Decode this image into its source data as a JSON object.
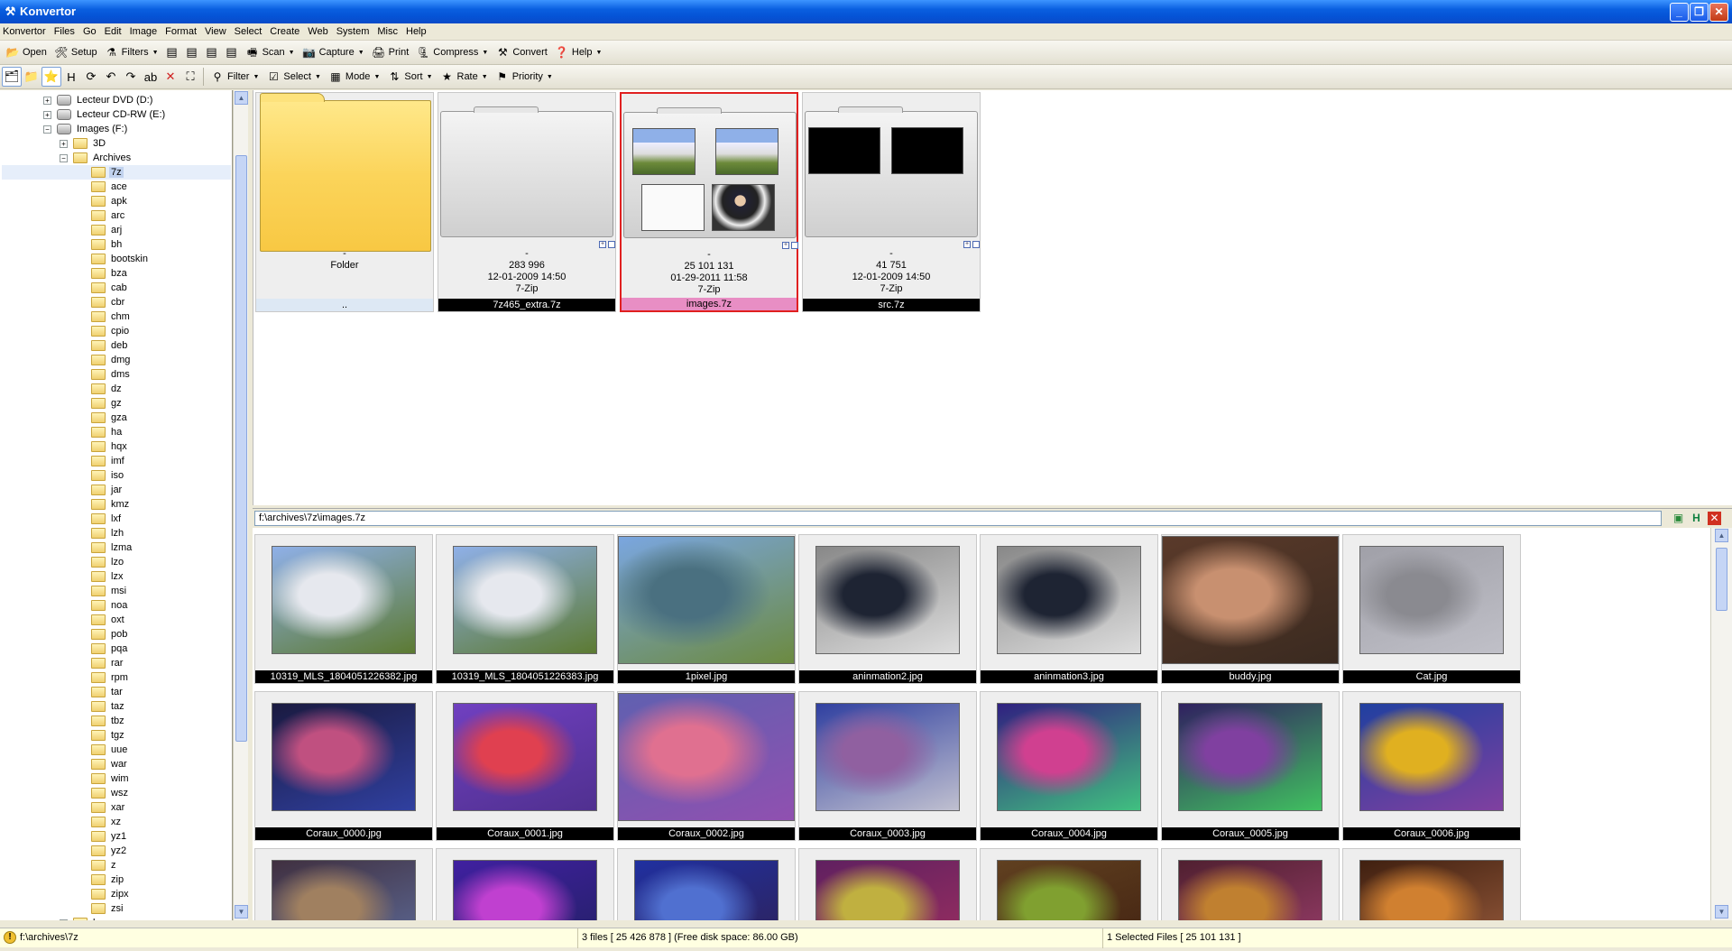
{
  "window": {
    "title": "Konvertor"
  },
  "menu": [
    "Konvertor",
    "Files",
    "Go",
    "Edit",
    "Image",
    "Format",
    "View",
    "Select",
    "Create",
    "Web",
    "System",
    "Misc",
    "Help"
  ],
  "toolbar1": [
    {
      "label": "Open",
      "icon": "open-icon",
      "glyph": "📂"
    },
    {
      "label": "Setup",
      "icon": "setup-icon",
      "glyph": "🛠"
    },
    {
      "label": "Filters",
      "icon": "filters-icon",
      "glyph": "⚗",
      "dropdown": true
    }
  ],
  "toolbar1b": [
    {
      "label": "Scan",
      "icon": "scan-icon",
      "glyph": "🖷",
      "dropdown": true
    },
    {
      "label": "Capture",
      "icon": "capture-icon",
      "glyph": "📷",
      "dropdown": true
    },
    {
      "label": "Print",
      "icon": "print-icon",
      "glyph": "🖨"
    },
    {
      "label": "Compress",
      "icon": "compress-icon",
      "glyph": "🗜",
      "dropdown": true
    },
    {
      "label": "Convert",
      "icon": "convert-icon",
      "glyph": "⚒"
    },
    {
      "label": "Help",
      "icon": "help-icon",
      "glyph": "❓",
      "dropdown": true
    }
  ],
  "toolbar2": [
    {
      "label": "Filter",
      "icon": "filter-icon",
      "glyph": "⚲"
    },
    {
      "label": "Select",
      "icon": "select-icon",
      "glyph": "☑"
    },
    {
      "label": "Mode",
      "icon": "mode-icon",
      "glyph": "▦"
    },
    {
      "label": "Sort",
      "icon": "sort-icon",
      "glyph": "⇅"
    },
    {
      "label": "Rate",
      "icon": "rate-icon",
      "glyph": "★"
    },
    {
      "label": "Priority",
      "icon": "priority-icon",
      "glyph": "⚑"
    }
  ],
  "tree": {
    "drives": [
      {
        "label": "Lecteur DVD (D:)",
        "expander": "+"
      },
      {
        "label": "Lecteur CD-RW (E:)",
        "expander": "+"
      },
      {
        "label": "Images (F:)",
        "expander": "−"
      }
    ],
    "level1": [
      {
        "label": "3D",
        "expander": "+"
      },
      {
        "label": "Archives",
        "expander": "−"
      }
    ],
    "archives": [
      "7z",
      "ace",
      "apk",
      "arc",
      "arj",
      "bh",
      "bootskin",
      "bza",
      "cab",
      "cbr",
      "chm",
      "cpio",
      "deb",
      "dmg",
      "dms",
      "dz",
      "gz",
      "gza",
      "ha",
      "hqx",
      "imf",
      "iso",
      "jar",
      "kmz",
      "lxf",
      "lzh",
      "lzma",
      "lzo",
      "lzx",
      "msi",
      "noa",
      "oxt",
      "pob",
      "pqa",
      "rar",
      "rpm",
      "tar",
      "taz",
      "tbz",
      "tgz",
      "uue",
      "war",
      "wim",
      "wsz",
      "xar",
      "xz",
      "yz1",
      "yz2",
      "z",
      "zip",
      "zipx",
      "zsi"
    ],
    "selected": "7z",
    "last": {
      "label": "bases",
      "expander": "+"
    }
  },
  "folders": [
    {
      "name": "..",
      "lines": [
        "-",
        "Folder"
      ],
      "kind": "folder"
    },
    {
      "name": "7z465_extra.7z",
      "lines": [
        "-",
        "283 996",
        "12-01-2009  14:50",
        "7-Zip"
      ],
      "kind": "empty"
    },
    {
      "name": "images.7z",
      "lines": [
        "-",
        "25 101 131",
        "01-29-2011  11:58",
        "7-Zip"
      ],
      "kind": "images",
      "selected": true
    },
    {
      "name": "src.7z",
      "lines": [
        "-",
        "41 751",
        "12-01-2009  14:50",
        "7-Zip"
      ],
      "kind": "src"
    }
  ],
  "path": "f:\\archives\\7z\\images.7z",
  "images": [
    {
      "name": "10319_MLS_1804051226382.jpg",
      "c1": "#8fb0e8",
      "c2": "#e6e8ee",
      "c3": "#5c7a32"
    },
    {
      "name": "10319_MLS_1804051226383.jpg",
      "c1": "#8fb0e8",
      "c2": "#e6e8ee",
      "c3": "#5c7a32"
    },
    {
      "name": "1pixel.jpg",
      "c1": "#7aa6e0",
      "c2": "#4a7080",
      "c3": "#6c8a40"
    },
    {
      "name": "aninmation2.jpg",
      "c1": "#888",
      "c2": "#1e2433",
      "c3": "#ddd"
    },
    {
      "name": "aninmation3.jpg",
      "c1": "#888",
      "c2": "#1e2433",
      "c3": "#ddd"
    },
    {
      "name": "buddy.jpg",
      "c1": "#5a3a2a",
      "c2": "#c89070",
      "c3": "#3a2a20"
    },
    {
      "name": "Cat.jpg",
      "c1": "#a0a0a8",
      "c2": "#8a8a90",
      "c3": "#c0c0c8"
    },
    {
      "name": "Coraux_0000.jpg",
      "c1": "#1a1a40",
      "c2": "#c05080",
      "c3": "#3040a0"
    },
    {
      "name": "Coraux_0001.jpg",
      "c1": "#7040c0",
      "c2": "#e04050",
      "c3": "#503090"
    },
    {
      "name": "Coraux_0002.jpg",
      "c1": "#6060b0",
      "c2": "#e07090",
      "c3": "#9050b0"
    },
    {
      "name": "Coraux_0003.jpg",
      "c1": "#3040a0",
      "c2": "#9060a0",
      "c3": "#c0c0d0"
    },
    {
      "name": "Coraux_0004.jpg",
      "c1": "#302080",
      "c2": "#d04090",
      "c3": "#40c080"
    },
    {
      "name": "Coraux_0005.jpg",
      "c1": "#302060",
      "c2": "#8040a0",
      "c3": "#40c060"
    },
    {
      "name": "Coraux_0006.jpg",
      "c1": "#2040a0",
      "c2": "#e0b020",
      "c3": "#8040a0"
    },
    {
      "name": "",
      "c1": "#403040",
      "c2": "#a08060",
      "c3": "#6070a0"
    },
    {
      "name": "",
      "c1": "#4020a0",
      "c2": "#c040d0",
      "c3": "#202060"
    },
    {
      "name": "",
      "c1": "#2030a0",
      "c2": "#5070d0",
      "c3": "#302050"
    },
    {
      "name": "",
      "c1": "#602060",
      "c2": "#c0b040",
      "c3": "#a03060"
    },
    {
      "name": "",
      "c1": "#604020",
      "c2": "#80a030",
      "c3": "#402010"
    },
    {
      "name": "",
      "c1": "#502030",
      "c2": "#c08030",
      "c3": "#a04070"
    },
    {
      "name": "",
      "c1": "#402010",
      "c2": "#d08030",
      "c3": "#a06040"
    }
  ],
  "status": {
    "path": "f:\\archives\\7z",
    "files": "3 files [ 25 426 878 ]  (Free disk space: 86.00 GB)",
    "selection": "1 Selected Files  [ 25 101 131 ]"
  },
  "colors": {
    "selection_border": "#e02020",
    "selected_label": "#e88ec4",
    "titlebar": "#0a5fe0"
  }
}
